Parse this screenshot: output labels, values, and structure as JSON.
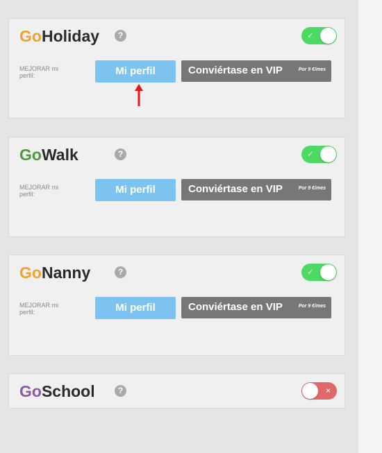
{
  "colors": {
    "orange": "#f0a22e",
    "green": "#4f9a3e",
    "purple": "#8a5aa6",
    "toggle_on": "#4cd964",
    "toggle_off": "#e06868",
    "profile_button": "#7cc4ef",
    "vip_button": "#777777"
  },
  "common": {
    "help_glyph": "?",
    "improve_label": "MEJORAR mi perfil:",
    "profile_button": "Mi perfil",
    "vip_button": "Conviértase en VIP",
    "vip_price": "Por 9 €/mes",
    "check_glyph": "✓",
    "cross_glyph": "×"
  },
  "services": [
    {
      "prefix": "Go",
      "name": "Holiday",
      "enabled": true
    },
    {
      "prefix": "Go",
      "name": "Walk",
      "enabled": true
    },
    {
      "prefix": "Go",
      "name": "Nanny",
      "enabled": true
    },
    {
      "prefix": "Go",
      "name": "School",
      "enabled": false
    }
  ]
}
